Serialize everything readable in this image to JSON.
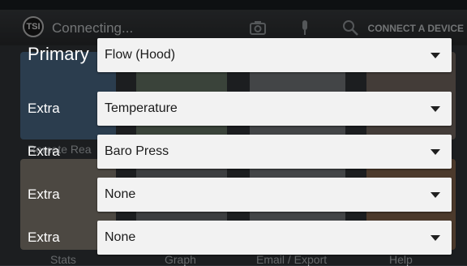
{
  "header": {
    "logo_text": "TSI",
    "title": "Connecting...",
    "connect_label": "CONNECT A DEVICE",
    "icons": [
      "camera-icon",
      "microphone-icon",
      "search-icon"
    ]
  },
  "background_tiles": {
    "labels": [
      "Remote Rea",
      "Stats",
      "Graph",
      "Email / Export",
      "Help"
    ]
  },
  "dialog": {
    "rows": [
      {
        "label": "Primary",
        "value": "Flow (Hood)"
      },
      {
        "label": "Extra",
        "value": "Temperature"
      },
      {
        "label": "Extra",
        "value": "Baro Press"
      },
      {
        "label": "Extra",
        "value": "None"
      },
      {
        "label": "Extra",
        "value": "None"
      }
    ]
  }
}
